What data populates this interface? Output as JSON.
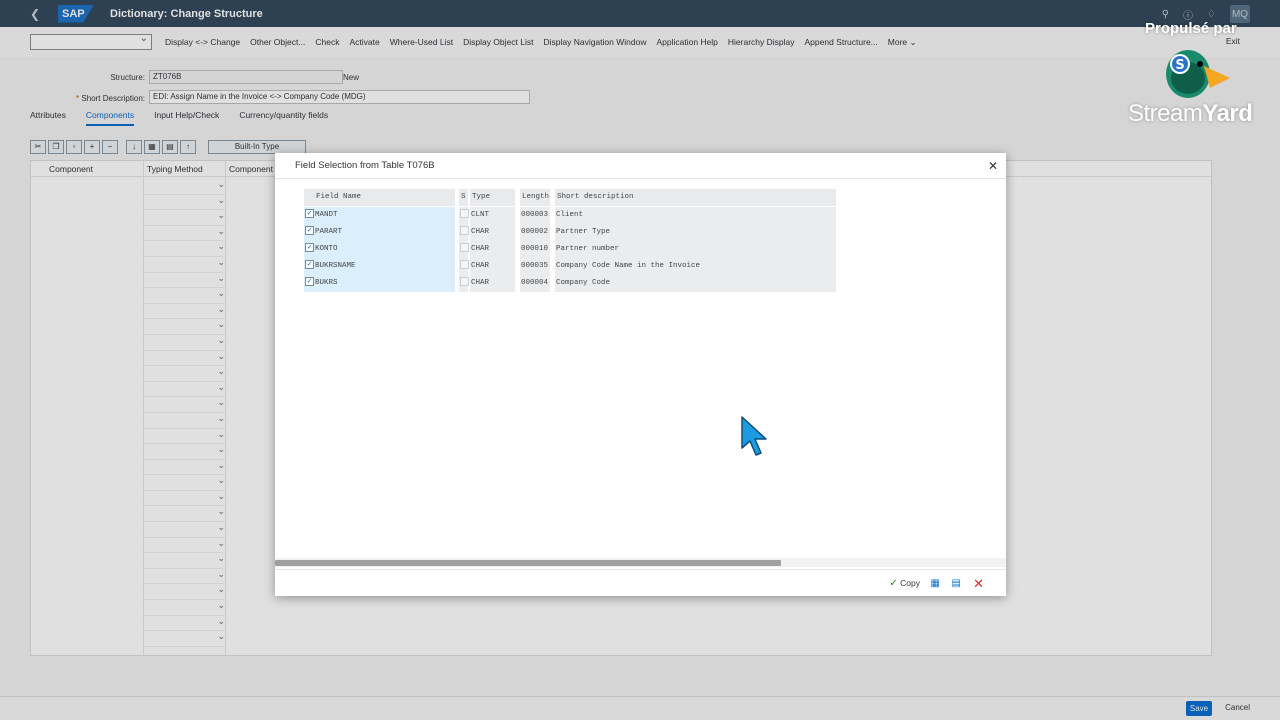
{
  "shell": {
    "title": "Dictionary: Change Structure",
    "logo": "SAP",
    "avatar": "MQ"
  },
  "toolbar": {
    "items": [
      "Display <-> Change",
      "Other Object...",
      "Check",
      "Activate",
      "Where-Used List",
      "Display Object List",
      "Display Navigation Window",
      "Application Help",
      "Hierarchy Display",
      "Append Structure...",
      "More"
    ],
    "exit": "Exit"
  },
  "form": {
    "structure_label": "Structure:",
    "structure_value": "ZT076B",
    "structure_status": "New",
    "short_desc_label": "Short Description:",
    "short_desc_value": "EDI: Assign Name in the Invoice <-> Company Code (MDG)"
  },
  "tabs": [
    "Attributes",
    "Components",
    "Input Help/Check",
    "Currency/quantity fields"
  ],
  "table": {
    "builtin_button": "Built-In Type",
    "columns": [
      "Component",
      "Typing Method",
      "Component"
    ]
  },
  "dialog": {
    "title": "Field Selection from Table T076B",
    "headers": {
      "field_name": "Field Name",
      "s": "S",
      "type": "Type",
      "length": "Length",
      "short_desc": "Short description"
    },
    "rows": [
      {
        "name": "MANDT",
        "type": "CLNT",
        "length": "000003",
        "desc": "Client"
      },
      {
        "name": "PARART",
        "type": "CHAR",
        "length": "000002",
        "desc": "Partner Type"
      },
      {
        "name": "KONTO",
        "type": "CHAR",
        "length": "000010",
        "desc": "Partner number"
      },
      {
        "name": "BUKRSNAME",
        "type": "CHAR",
        "length": "000035",
        "desc": "Company Code Name in the Invoice"
      },
      {
        "name": "BUKRS",
        "type": "CHAR",
        "length": "000004",
        "desc": "Company Code"
      }
    ],
    "copy": "Copy"
  },
  "footer": {
    "save": "Save",
    "cancel": "Cancel"
  },
  "overlay_brand": {
    "label": "Propulsé par",
    "brand_a": "Stream",
    "brand_b": "Yard"
  },
  "colors": {
    "shell": "#354a5f",
    "accent": "#0a6ed1",
    "cursor": "#1e9be0"
  }
}
